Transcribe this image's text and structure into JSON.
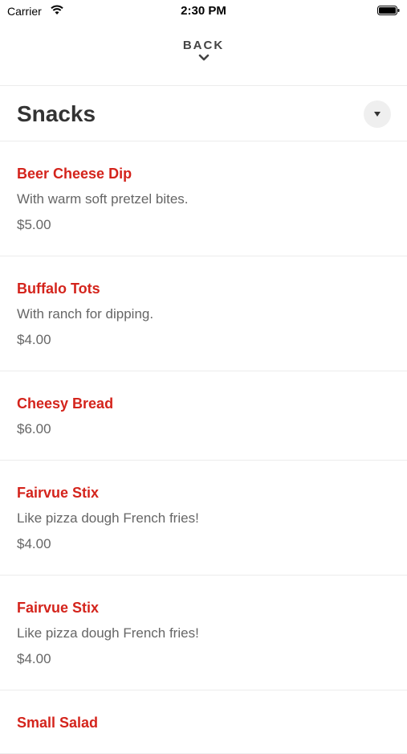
{
  "status": {
    "carrier": "Carrier",
    "time": "2:30 PM"
  },
  "nav": {
    "back_label": "BACK"
  },
  "section": {
    "title": "Snacks"
  },
  "items": [
    {
      "name": "Beer Cheese Dip",
      "description": "With warm soft pretzel bites.",
      "price": "$5.00"
    },
    {
      "name": "Buffalo Tots",
      "description": "With ranch for dipping.",
      "price": "$4.00"
    },
    {
      "name": "Cheesy Bread",
      "description": "",
      "price": "$6.00"
    },
    {
      "name": "Fairvue Stix",
      "description": "Like pizza dough French fries!",
      "price": "$4.00"
    },
    {
      "name": "Fairvue Stix",
      "description": "Like pizza dough French fries!",
      "price": "$4.00"
    },
    {
      "name": "Small Salad",
      "description": "",
      "price": ""
    }
  ],
  "colors": {
    "accent": "#d4241c",
    "divider": "#ececec"
  }
}
